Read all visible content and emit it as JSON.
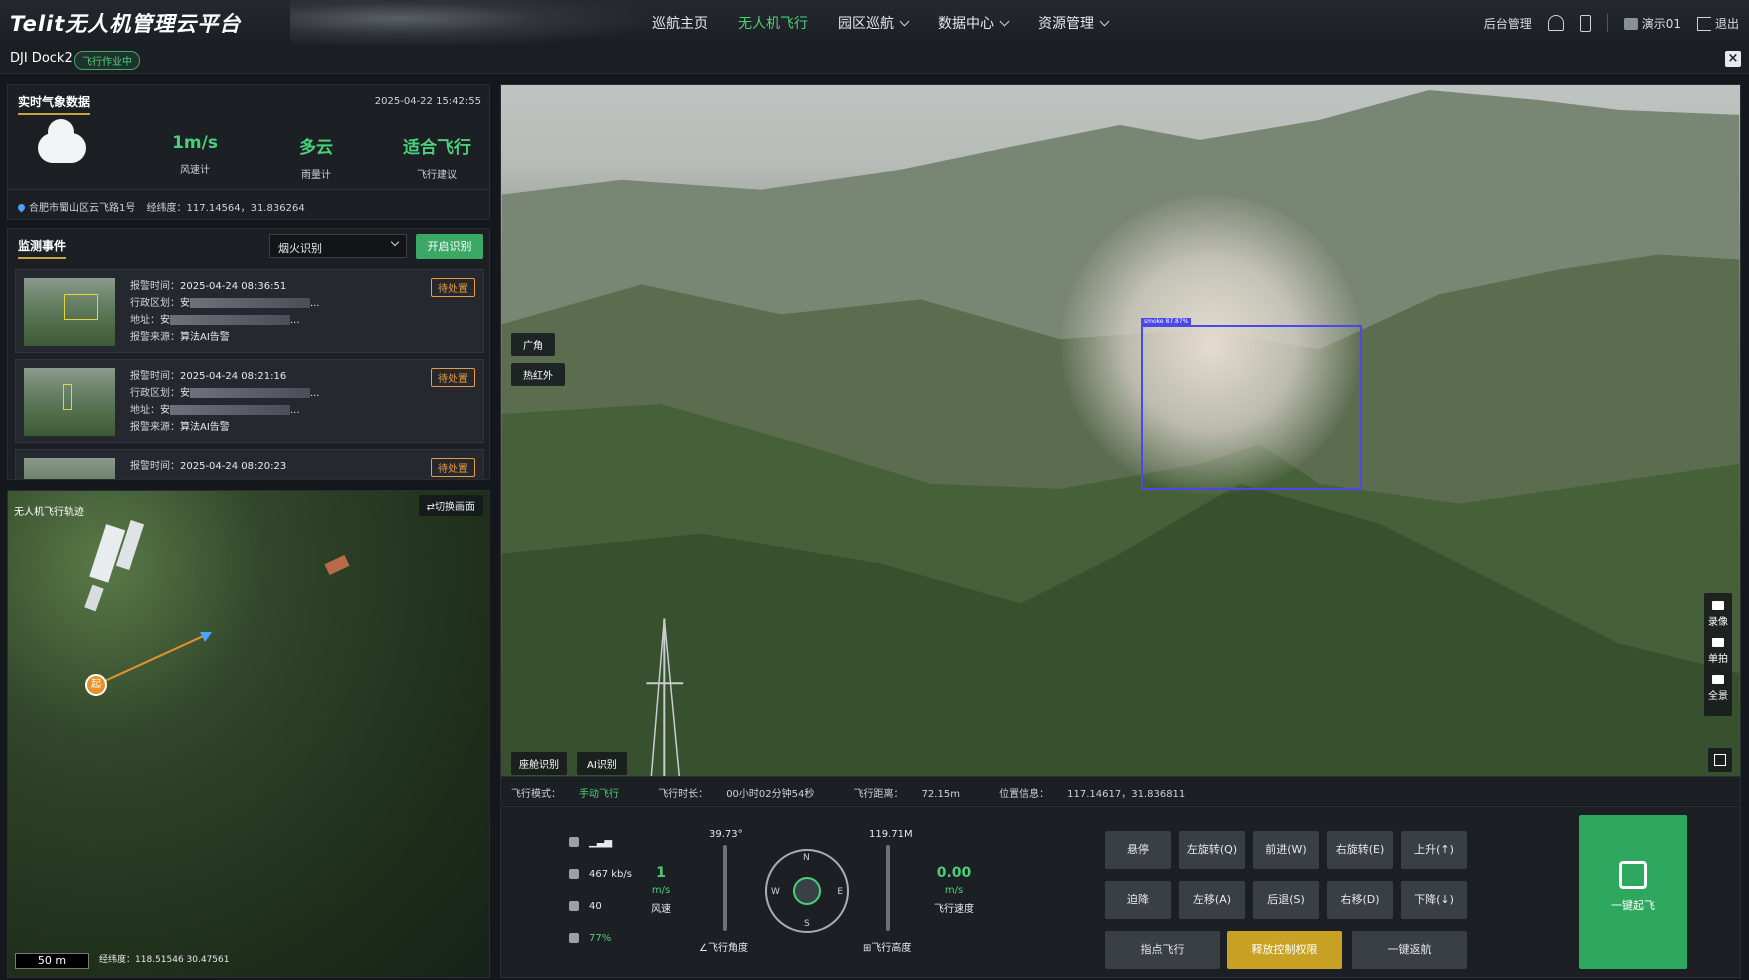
{
  "header": {
    "logo": "Telit无人机管理云平台",
    "nav": [
      {
        "label": "巡航主页",
        "active": false,
        "dropdown": false
      },
      {
        "label": "无人机飞行",
        "active": true,
        "dropdown": false
      },
      {
        "label": "园区巡航",
        "active": false,
        "dropdown": true
      },
      {
        "label": "数据中心",
        "active": false,
        "dropdown": true
      },
      {
        "label": "资源管理",
        "active": false,
        "dropdown": true
      }
    ],
    "admin_label": "后台管理",
    "user_label": "演示01",
    "logout_label": "退出",
    "icons": [
      "bell-icon",
      "phone-icon",
      "avatar-icon",
      "logout-icon"
    ]
  },
  "subbar": {
    "dock_name": "DJI Dock2",
    "status_badge": "飞行作业中",
    "close_icon": "close-icon"
  },
  "weather": {
    "title": "实时气象数据",
    "timestamp": "2025-04-22 15:42:55",
    "icon": "cloud-icon",
    "stats": [
      {
        "value": "1m/s",
        "label": "风速计"
      },
      {
        "value": "多云",
        "label": "雨量计"
      },
      {
        "value": "适合飞行",
        "label": "飞行建议"
      }
    ],
    "location": "合肥市蜀山区云飞路1号",
    "coords_label": "经纬度：117.14564，31.836264"
  },
  "events": {
    "title": "监测事件",
    "filter_selected": "烟火识别",
    "start_button": "开启识别",
    "items": [
      {
        "time_label": "报警时间：",
        "time": "2025-04-24 08:36:51",
        "region_label": "行政区划：",
        "region_prefix": "安",
        "region_suffix": "...",
        "addr_label": "地址：",
        "addr_prefix": "安",
        "addr_suffix": "...",
        "source_label": "报警来源：",
        "source": "算法AI告警",
        "status": "待处置"
      },
      {
        "time_label": "报警时间：",
        "time": "2025-04-24 08:21:16",
        "region_label": "行政区划：",
        "region_prefix": "安",
        "region_suffix": "...",
        "addr_label": "地址：",
        "addr_prefix": "安",
        "addr_suffix": "...",
        "source_label": "报警来源：",
        "source": "算法AI告警",
        "status": "待处置"
      },
      {
        "time_label": "报警时间：",
        "time": "2025-04-24 08:20:23",
        "status": "待处置"
      }
    ]
  },
  "map": {
    "title": "无人机飞行轨迹",
    "switch_button": "⇄切换画面",
    "scale": "50 m",
    "coords": "经纬度：118.51546 30.47561",
    "home_marker": "起"
  },
  "video": {
    "lens_buttons": [
      "广角",
      "热红外"
    ],
    "bottom_buttons": [
      "座舱识别",
      "AI识别"
    ],
    "detection_label": "smoke 87.87%",
    "tools": [
      {
        "label": "录像",
        "icon": "video-camera-icon"
      },
      {
        "label": "单拍",
        "icon": "camera-icon"
      },
      {
        "label": "全景",
        "icon": "panorama-pin-icon"
      }
    ]
  },
  "flight_info": {
    "mode_label": "飞行模式：",
    "mode": "手动飞行",
    "duration_label": "飞行时长：",
    "duration": "00小时02分钟54秒",
    "distance_label": "飞行距离：",
    "distance": "72.15m",
    "position_label": "位置信息：",
    "position": "117.14617，31.836811"
  },
  "telemetry": {
    "signal": "",
    "bandwidth": "467 kb/s",
    "satellites": "40",
    "battery": "77%",
    "wind_value": "1",
    "wind_unit": "m/s",
    "wind_label": "风速",
    "angle_value": "39.73°",
    "angle_label": "飞行角度",
    "altitude_value": "119.71M",
    "altitude_label": "飞行高度",
    "speed_value": "0.00",
    "speed_unit": "m/s",
    "speed_label": "飞行速度",
    "compass": {
      "n": "N",
      "e": "E",
      "s": "S",
      "w": "W"
    }
  },
  "controls": {
    "row1": [
      "悬停",
      "左旋转(Q)",
      "前进(W)",
      "右旋转(E)",
      "上升(↑)"
    ],
    "row2": [
      "迫降",
      "左移(A)",
      "后退(S)",
      "右移(D)",
      "下降(↓)"
    ],
    "row3": [
      "指点飞行",
      "释放控制权限",
      "一键返航"
    ],
    "takeoff": "一键起飞"
  },
  "colors": {
    "accent_green": "#4ad07a",
    "button_green": "#3ca865",
    "pending_orange": "#e89a3c",
    "gold": "#c8a023",
    "detection_blue": "#4a48e8"
  }
}
